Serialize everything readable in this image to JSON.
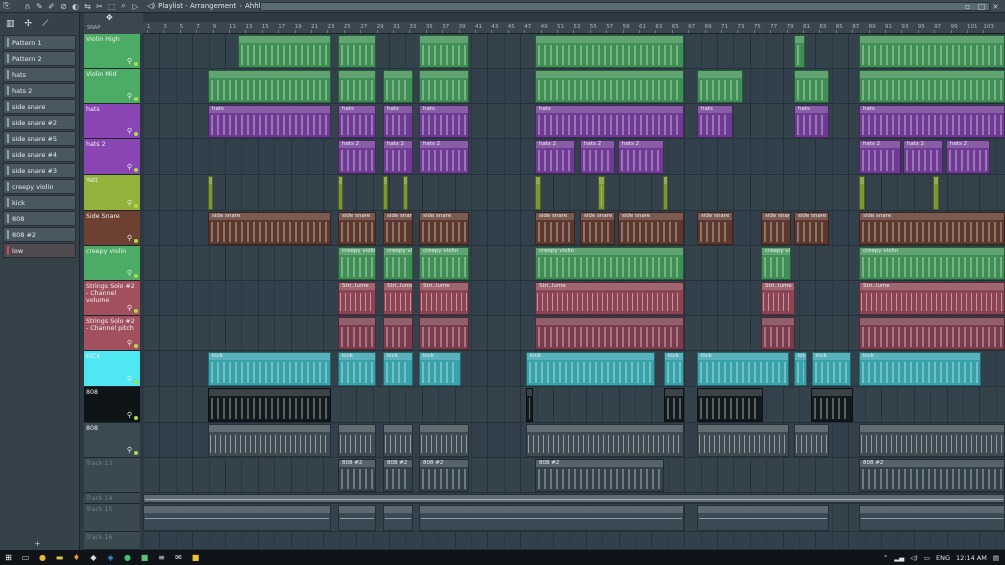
{
  "window": {
    "title": "Playlist - Arrangement",
    "project": "Ahhhh"
  },
  "toolbar_icons": [
    "magnet-icon",
    "pencil-icon",
    "brush-icon",
    "delete-icon",
    "mute-icon",
    "slip-icon",
    "slice-icon",
    "select-icon",
    "zoom-icon",
    "playback-icon"
  ],
  "sidebar": {
    "patterns": [
      {
        "label": "Pattern 1",
        "active": false
      },
      {
        "label": "Pattern 2",
        "active": false
      },
      {
        "label": "hats",
        "active": false
      },
      {
        "label": "hats 2",
        "active": false
      },
      {
        "label": "side snare",
        "active": false
      },
      {
        "label": "side snare #2",
        "active": false
      },
      {
        "label": "side snare #5",
        "active": false
      },
      {
        "label": "side snare #4",
        "active": false
      },
      {
        "label": "side snare #3",
        "active": false
      },
      {
        "label": "creepy violin",
        "active": false
      },
      {
        "label": "kick",
        "active": false
      },
      {
        "label": "808",
        "active": false
      },
      {
        "label": "808 #2",
        "active": false
      },
      {
        "label": "low",
        "active": true
      }
    ],
    "add_label": "+"
  },
  "ruler": {
    "label": "SNAP",
    "bars": [
      "1",
      "3",
      "5",
      "7",
      "9",
      "11",
      "13",
      "15",
      "17",
      "19",
      "21",
      "23",
      "25",
      "27",
      "29",
      "31",
      "33",
      "35",
      "37",
      "39",
      "41",
      "43",
      "45",
      "47",
      "49",
      "51",
      "53",
      "55",
      "57",
      "59",
      "61",
      "63",
      "65",
      "67",
      "69",
      "71",
      "73",
      "75",
      "77",
      "79",
      "81",
      "83",
      "85",
      "87",
      "89",
      "91",
      "93",
      "95",
      "97",
      "99",
      "101",
      "103"
    ]
  },
  "tracks": [
    {
      "name": "Violin High",
      "color": "#4cab64",
      "dim": false
    },
    {
      "name": "Violin Mid",
      "color": "#4cab64",
      "dim": false
    },
    {
      "name": "hats",
      "color": "#8a47b3",
      "dim": false
    },
    {
      "name": "hats 2",
      "color": "#8a47b3",
      "dim": false
    },
    {
      "name": "Yatt",
      "color": "#93b23b",
      "dim": false
    },
    {
      "name": "Side Snare",
      "color": "#6e4032",
      "dim": false
    },
    {
      "name": "creepy violin",
      "color": "#4cab64",
      "dim": false
    },
    {
      "name": "Strings Solo #2 - Channel volume",
      "color": "#a2505d",
      "dim": false
    },
    {
      "name": "Strings Solo #2 - Channel pitch",
      "color": "#a2505d",
      "dim": false
    },
    {
      "name": "KICK",
      "color": "#4fe7f2",
      "dim": false
    },
    {
      "name": "808",
      "color": "#0f1416",
      "dim": false
    },
    {
      "name": "808",
      "color": "#3b4951",
      "dim": false
    },
    {
      "name": "Track 13",
      "color": "#3b4951",
      "dim": true
    },
    {
      "name": "Track 14",
      "color": "#3b4951",
      "dim": true
    },
    {
      "name": "Track 15",
      "color": "#3b4951",
      "dim": true
    },
    {
      "name": "Track 16",
      "color": "#3b4951",
      "dim": true
    }
  ],
  "taskbar": {
    "lang": "ENG",
    "time": "12:14 AM"
  }
}
